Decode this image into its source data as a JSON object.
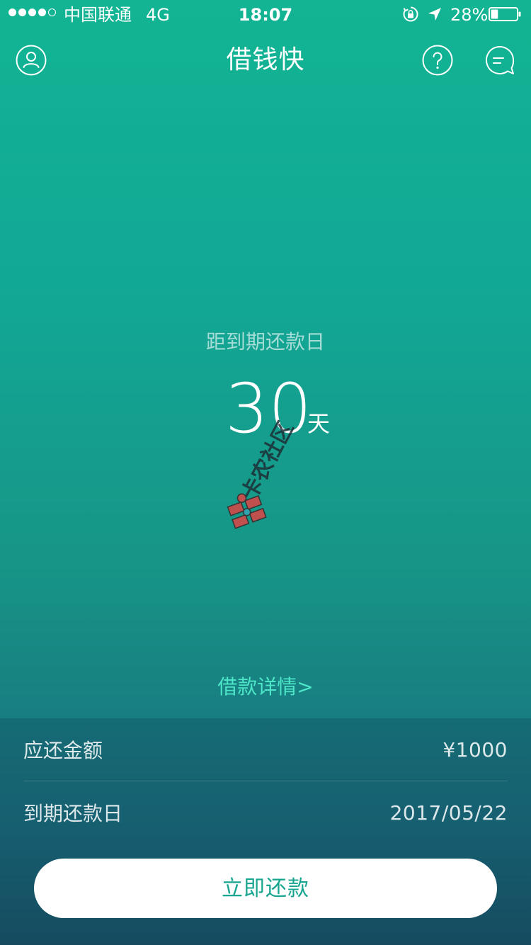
{
  "status_bar": {
    "carrier": "中国联通",
    "network": "4G",
    "time": "18:07",
    "battery_percent": "28%",
    "battery_level": 0.28,
    "icons": [
      "signal-icon",
      "orientation-lock-icon",
      "location-icon",
      "battery-icon"
    ]
  },
  "header": {
    "title": "借钱快",
    "icons": [
      "user-icon",
      "help-icon",
      "message-icon"
    ]
  },
  "countdown": {
    "label": "距到期还款日",
    "days": "30",
    "unit": "天"
  },
  "loan_detail_link": "借款详情>",
  "watermark": {
    "text": "卡农社区"
  },
  "info": {
    "amount_label": "应还金额",
    "amount_value": "¥1000",
    "due_label": "到期还款日",
    "due_value": "2017/05/22"
  },
  "repay_button": "立即还款",
  "colors": {
    "gradient_top": "#12B493",
    "gradient_bottom": "#1A5466",
    "accent_link": "#4EE6C8",
    "button_text": "#17A590",
    "button_bg": "#FFFFFF"
  }
}
